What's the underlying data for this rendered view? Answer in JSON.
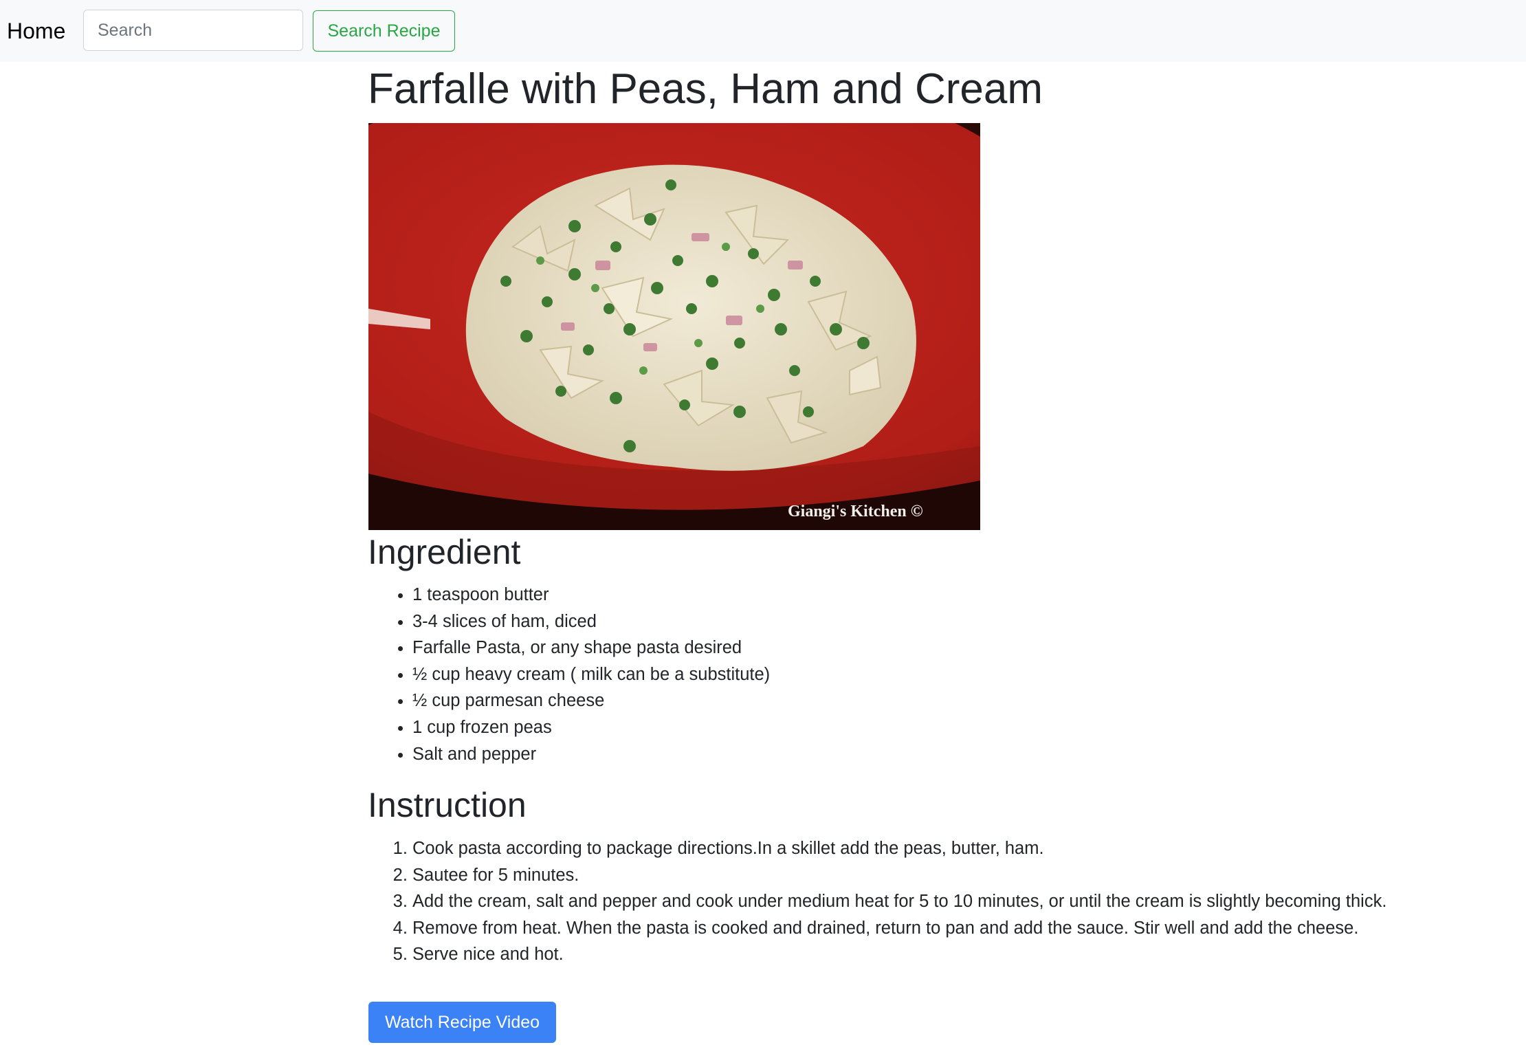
{
  "nav": {
    "home_label": "Home",
    "search_placeholder": "Search",
    "search_value": "",
    "search_button_label": "Search Recipe",
    "accent_color": "#28a745",
    "background_color": "#f8f9fa"
  },
  "recipe": {
    "title": "Farfalle with Peas, Ham and Cream",
    "image_watermark": "Giangi's Kitchen ©",
    "ingredient_heading": "Ingredient",
    "ingredients": [
      "1 teaspoon butter",
      "3-4 slices of ham, diced",
      "Farfalle Pasta, or any shape pasta desired",
      "½ cup heavy cream ( milk can be a substitute)",
      "½ cup parmesan cheese",
      "1 cup frozen peas",
      "Salt and pepper"
    ],
    "instruction_heading": "Instruction",
    "instructions": [
      "Cook pasta according to package directions.In a skillet add the peas, butter, ham.",
      "Sautee for 5 minutes.",
      "Add the cream, salt and pepper and cook under medium heat for 5 to 10 minutes, or until the cream is slightly becoming thick.",
      "Remove from heat. When the pasta is cooked and drained, return to pan and add the sauce. Stir well and add the cheese.",
      "Serve nice and hot."
    ],
    "video_button_label": "Watch Recipe Video",
    "video_button_color": "#3b82f6"
  }
}
